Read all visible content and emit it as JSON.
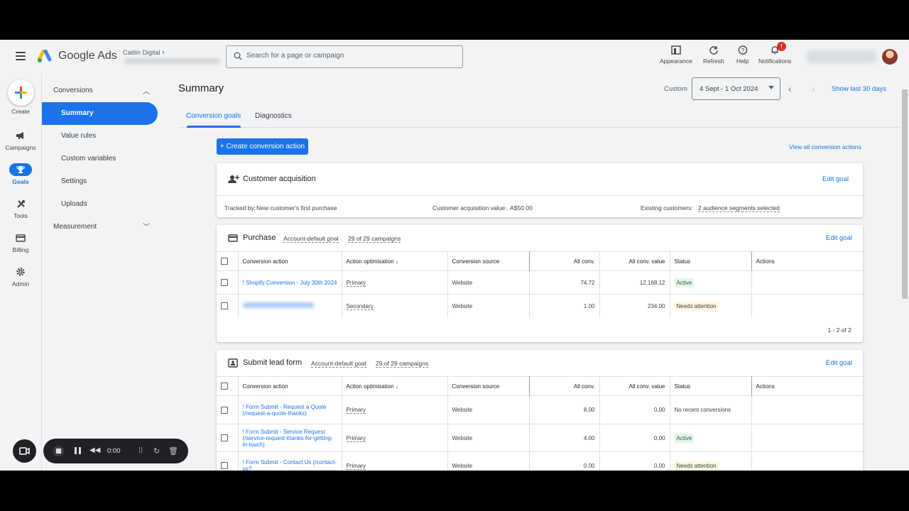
{
  "topbar": {
    "brand": "Google Ads",
    "account_name": "Caitlin Digital",
    "search_placeholder": "Search for a page or campaign",
    "tools": [
      {
        "label": "Appearance"
      },
      {
        "label": "Refresh"
      },
      {
        "label": "Help"
      },
      {
        "label": "Notifications"
      }
    ],
    "notification_badge": "!"
  },
  "leftnav": {
    "create_label": "Create",
    "items": [
      {
        "label": "Campaigns"
      },
      {
        "label": "Goals"
      },
      {
        "label": "Tools"
      },
      {
        "label": "Billing"
      },
      {
        "label": "Admin"
      }
    ]
  },
  "subnav": {
    "section": "Conversions",
    "items": [
      "Summary",
      "Value rules",
      "Custom variables",
      "Settings",
      "Uploads"
    ],
    "section2": "Measurement"
  },
  "main": {
    "title": "Summary",
    "date_label": "Custom",
    "date_range": "4 Sept - 1 Oct 2024",
    "show_last": "Show last 30 days",
    "tabs": [
      "Conversion goals",
      "Diagnostics"
    ],
    "create_button": "+ Create conversion action",
    "view_all": "View all conversion actions"
  },
  "acquisition": {
    "title": "Customer acquisition",
    "edit": "Edit goal",
    "tracked_label": "Tracked by:",
    "tracked_value": "New customer's first purchase",
    "value_label": "Customer acquisition value:",
    "value_value": "A$50.00",
    "existing_label": "Existing customers:",
    "existing_value": "2 audience segments selected"
  },
  "columns": [
    "Conversion action",
    "Action optimisation",
    "Conversion source",
    "All conv.",
    "All conv. value",
    "Status",
    "Actions"
  ],
  "purchase": {
    "title": "Purchase",
    "default": "Account-default goal",
    "campaigns": "29 of 29 campaigns",
    "edit": "Edit goal",
    "rows": [
      {
        "action": "! Shopify Conversion - July 30th 2024",
        "opt": "Primary",
        "source": "Website",
        "conv": "74.72",
        "value": "12,168.12",
        "status": "Active"
      },
      {
        "action": "",
        "opt": "Secondary",
        "source": "Website",
        "conv": "1.00",
        "value": "234.00",
        "status": "Needs attention"
      }
    ],
    "pager": "1 - 2 of 2"
  },
  "lead": {
    "title": "Submit lead form",
    "default": "Account-default goal",
    "campaigns": "29 of 29 campaigns",
    "edit": "Edit goal",
    "rows": [
      {
        "action": "! Form Submit - Request a Quote (/request-a-quote-thanks)",
        "opt": "Primary",
        "source": "Website",
        "conv": "8.00",
        "value": "0.00",
        "status": "No recent conversions"
      },
      {
        "action": "! Form Submit - Service Request (/service-request-thanks-for-getting-in-touch)",
        "opt": "Primary",
        "source": "Website",
        "conv": "4.00",
        "value": "0.00",
        "status": "Active"
      },
      {
        "action": "! Form Submit - Contact Us (/contact-us?",
        "opt": "Primary",
        "source": "Website",
        "conv": "0.00",
        "value": "0.00",
        "status": "Needs attention"
      }
    ]
  },
  "recorder": {
    "time": "0:00"
  },
  "colors": {
    "accent": "#1a73e8",
    "active_bg": "#e6f4ea",
    "warn_bg": "#fef7e0",
    "badge": "#d93025"
  }
}
